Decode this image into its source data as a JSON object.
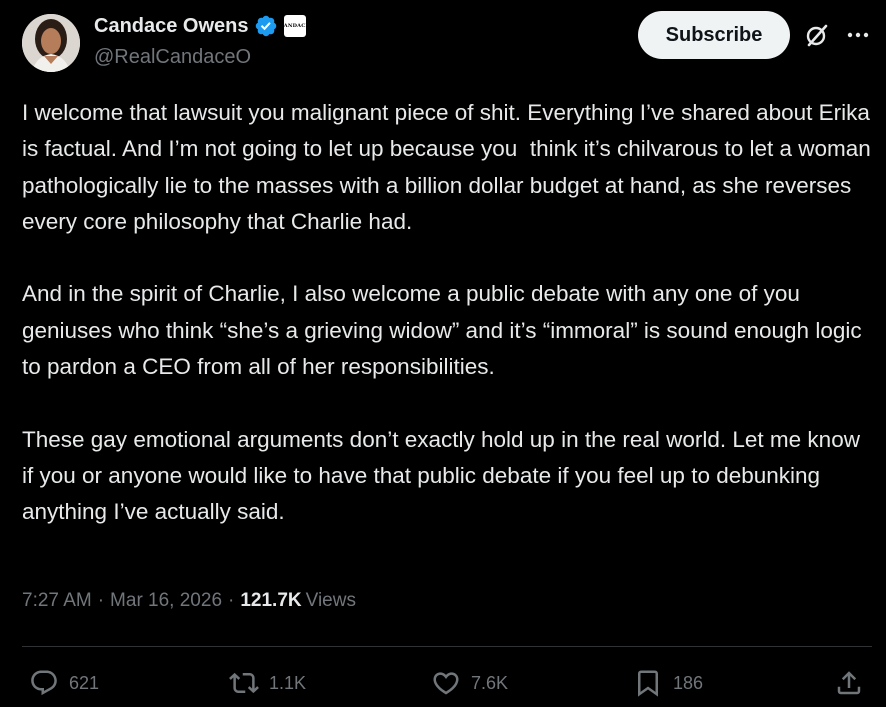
{
  "author": {
    "display_name": "Candace Owens",
    "handle": "@RealCandaceO",
    "affiliate_badge_text": "CANDACE"
  },
  "header": {
    "subscribe_label": "Subscribe"
  },
  "tweet": {
    "paragraphs": [
      "I welcome that lawsuit you malignant piece of shit. Everything I’ve shared about Erika is factual. And I’m not going to let up because you  think it’s chilvarous to let a woman pathologically lie to the masses with a billion dollar budget at hand, as she reverses every core philosophy that Charlie had.",
      "And in the spirit of Charlie, I also welcome a public debate with any one of you geniuses who think “she’s a grieving widow” and it’s “immoral” is sound enough logic to pardon a CEO from all of her responsibilities.",
      "These gay emotional arguments don’t exactly hold up in the real world. Let me know if you or anyone would like to have that public debate if you feel up to debunking anything I’ve actually said."
    ]
  },
  "meta": {
    "time": "7:27 AM",
    "separator": "·",
    "date": "Mar 16, 2026",
    "views_count": "121.7K",
    "views_label": "Views"
  },
  "actions": {
    "replies": "621",
    "reposts": "1.1K",
    "likes": "7.6K",
    "bookmarks": "186"
  },
  "colors": {
    "background": "#000000",
    "text_primary": "#e7e9ea",
    "text_secondary": "#71767b",
    "verified_blue": "#1d9bf0",
    "divider": "#2f3336",
    "subscribe_bg": "#eff3f4"
  },
  "icons": {
    "verified": "verified-badge-icon",
    "grok": "grok-icon",
    "more": "more-icon",
    "reply": "reply-icon",
    "repost": "repost-icon",
    "like": "heart-icon",
    "bookmark": "bookmark-icon",
    "share": "share-icon"
  }
}
